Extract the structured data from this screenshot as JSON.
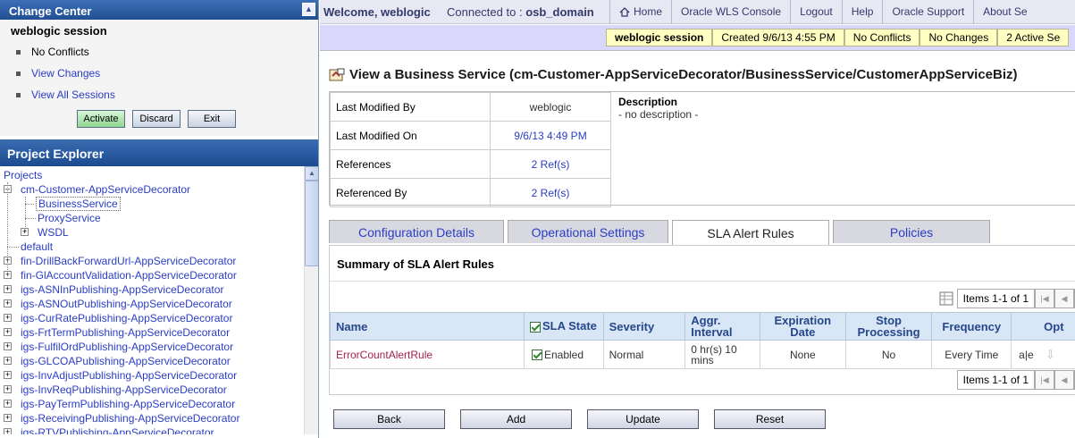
{
  "change_center": {
    "title": "Change Center",
    "session": "weblogic session",
    "items": [
      "No Conflicts",
      "View Changes",
      "View All Sessions"
    ],
    "buttons": {
      "activate": "Activate",
      "discard": "Discard",
      "exit": "Exit"
    }
  },
  "project_explorer": {
    "title": "Project Explorer",
    "projects_label": "Projects",
    "tree": [
      "cm-Customer-AppServiceDecorator",
      "BusinessService",
      "ProxyService",
      "WSDL",
      "default",
      "fin-DrillBackForwardUrl-AppServiceDecorator",
      "fin-GlAccountValidation-AppServiceDecorator",
      "igs-ASNInPublishing-AppServiceDecorator",
      "igs-ASNOutPublishing-AppServiceDecorator",
      "igs-CurRatePublishing-AppServiceDecorator",
      "igs-FrtTermPublishing-AppServiceDecorator",
      "igs-FulfilOrdPublishing-AppServiceDecorator",
      "igs-GLCOAPublishing-AppServiceDecorator",
      "igs-InvAdjustPublishing-AppServiceDecorator",
      "igs-InvReqPublishing-AppServiceDecorator",
      "igs-PayTermPublishing-AppServiceDecorator",
      "igs-ReceivingPublishing-AppServiceDecorator",
      "igs-RTVPublishing-AppServiceDecorator"
    ]
  },
  "topbar": {
    "welcome": "Welcome, weblogic",
    "connected_label": "Connected to :",
    "domain": "osb_domain",
    "nav": [
      "Home",
      "Oracle WLS Console",
      "Logout",
      "Help",
      "Oracle Support",
      "About Se"
    ]
  },
  "status": {
    "session": "weblogic session",
    "created": "Created 9/6/13 4:55 PM",
    "conflicts": "No Conflicts",
    "changes": "No Changes",
    "active": "2 Active Se"
  },
  "main": {
    "title": "View a Business Service (cm-Customer-AppServiceDecorator/BusinessService/CustomerAppServiceBiz)",
    "props": [
      {
        "key": "Last Modified By",
        "value": "weblogic"
      },
      {
        "key": "Last Modified On",
        "value": "9/6/13 4:49 PM"
      },
      {
        "key": "References",
        "value": "2 Ref(s)"
      },
      {
        "key": "Referenced By",
        "value": "2 Ref(s)"
      }
    ],
    "description_label": "Description",
    "description": "- no description -",
    "tabs": [
      "Configuration Details",
      "Operational Settings",
      "SLA Alert Rules",
      "Policies"
    ],
    "summary_title": "Summary of SLA Alert Rules",
    "pager": {
      "text": "Items 1-1 of 1",
      "page": "1"
    },
    "columns": [
      "Name",
      "SLA State",
      "Severity",
      "Aggr. Interval",
      "Expiration Date",
      "Stop Processing",
      "Frequency",
      "Opt"
    ],
    "rows": [
      {
        "name": "ErrorCountAlertRule",
        "state": "Enabled",
        "severity": "Normal",
        "interval": "0 hr(s) 10 mins",
        "expiration": "None",
        "stop": "No",
        "frequency": "Every Time",
        "opt": "a|e"
      }
    ],
    "actions": [
      "Back",
      "Add",
      "Update",
      "Reset"
    ]
  }
}
